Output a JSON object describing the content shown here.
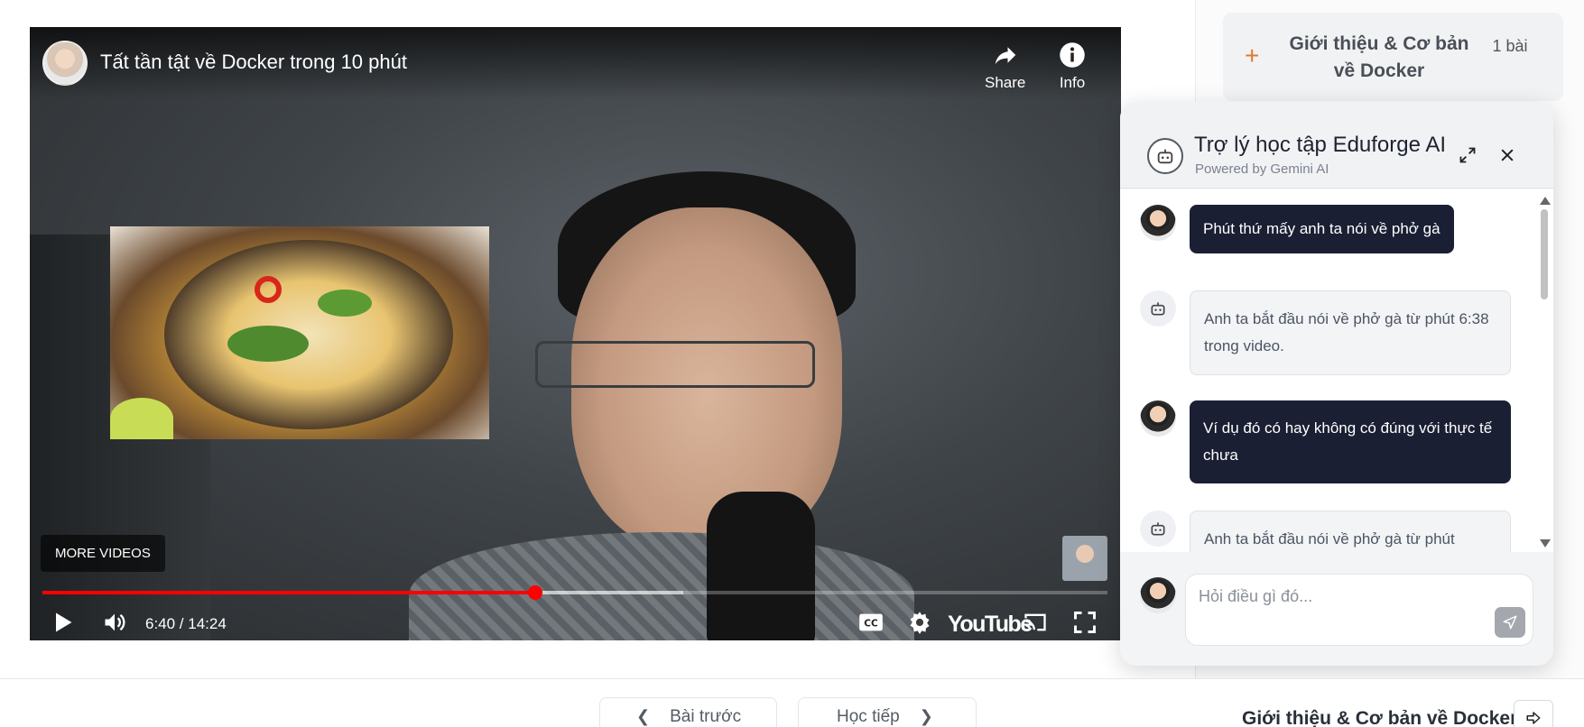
{
  "video": {
    "title": "Tất tần tật về Docker trong 10 phút",
    "share_label": "Share",
    "info_label": "Info",
    "more_videos_label": "MORE VIDEOS",
    "time_display": "6:40 / 14:24",
    "brand": "YouTube",
    "progress": {
      "played_fraction": 0.463,
      "buffered_fraction": 0.602
    }
  },
  "sidebar": {
    "module": {
      "plus_symbol": "+",
      "title": "Giới thiệu & Cơ bản về Docker",
      "count": "1 bài"
    }
  },
  "chat": {
    "title": "Trợ lý học tập Eduforge AI",
    "subtitle": "Powered by Gemini AI",
    "messages": [
      {
        "role": "user",
        "text": "Phút thứ mấy anh ta nói về phở gà"
      },
      {
        "role": "bot",
        "text": "Anh ta bắt đầu nói về phở gà từ phút 6:38 trong video."
      },
      {
        "role": "user",
        "text": "Ví dụ đó có hay không có đúng với thực tế chưa"
      },
      {
        "role": "bot",
        "text": "Anh ta bắt đầu nói về phở gà từ phút"
      }
    ],
    "input_placeholder": "Hỏi điều gì đó..."
  },
  "bottom_bar": {
    "prev_label": "Bài trước",
    "next_label": "Học tiếp",
    "current_module": "Giới thiệu & Cơ bản về Docker"
  },
  "colors": {
    "progress_red": "#ff0000",
    "accent_orange": "#e07b2e",
    "user_bubble": "#1a1f33",
    "bot_bubble": "#f3f4f6"
  },
  "icons": [
    "share-icon",
    "info-icon",
    "play-icon",
    "volume-icon",
    "cc-icon",
    "gear-icon",
    "cast-icon",
    "fullscreen-icon",
    "robot-icon",
    "expand-icon",
    "close-icon",
    "send-icon",
    "chevron-left-icon",
    "chevron-right-icon",
    "arrow-right-icon"
  ]
}
